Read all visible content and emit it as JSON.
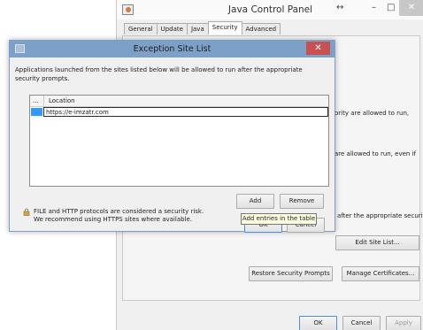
{
  "control_panel": {
    "title": "Java Control Panel",
    "restore_icon": "↔",
    "minimize_icon": "–",
    "maximize_icon": "□",
    "close_icon": "✕",
    "tabs": [
      {
        "label": "General"
      },
      {
        "label": "Update"
      },
      {
        "label": "Java"
      },
      {
        "label": "Security"
      },
      {
        "label": "Advanced"
      }
    ],
    "fragments": {
      "line1": "ority are allowed to run,",
      "line2": "are allowed to run, even if",
      "line3": "after the appropriate security"
    },
    "edit_site_list_label": "Edit Site List...",
    "restore_prompts_label": "Restore Security Prompts",
    "manage_certificates_label": "Manage Certificates...",
    "ok_label": "OK",
    "cancel_label": "Cancel",
    "apply_label": "Apply"
  },
  "exception_dialog": {
    "title": "Exception Site List",
    "close_icon": "✕",
    "description": "Applications launched from the sites listed below will be allowed to run after the appropriate security prompts.",
    "table": {
      "col_index": "...",
      "col_location": "Location",
      "rows": [
        {
          "location": "https://e-imzatr.com"
        }
      ]
    },
    "add_label": "Add",
    "remove_label": "Remove",
    "tooltip": "Add entries in the table",
    "warning_line1": "FILE and HTTP protocols are considered a security risk.",
    "warning_line2": "We recommend using HTTPS sites where available.",
    "ok_label": "OK",
    "cancel_label": "Cancel"
  },
  "colors": {
    "dialog_title_bar": "#7da0c9",
    "dialog_close": "#c75050",
    "selection": "#3399ff",
    "tooltip_bg": "#ffffe1"
  }
}
